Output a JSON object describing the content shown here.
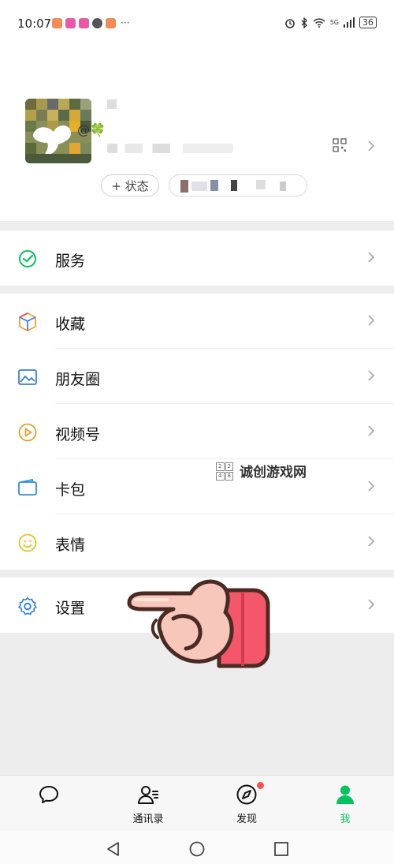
{
  "status_bar": {
    "time": "10:07",
    "more": "···",
    "network": "5G",
    "battery": "36"
  },
  "profile": {
    "nickname_fragment": "@🍀",
    "status_button": "+ 状态"
  },
  "menu": {
    "services": {
      "label": "服务"
    },
    "items": [
      {
        "label": "收藏"
      },
      {
        "label": "朋友圈"
      },
      {
        "label": "视频号"
      },
      {
        "label": "卡包"
      },
      {
        "label": "表情"
      }
    ],
    "settings": {
      "label": "设置"
    }
  },
  "watermark": {
    "text": "诚创游戏网",
    "grid": [
      "2",
      "2",
      "4",
      "8"
    ]
  },
  "tabbar": {
    "tabs": [
      {
        "label": ""
      },
      {
        "label": "通讯录"
      },
      {
        "label": "发现"
      },
      {
        "label": "我"
      }
    ]
  },
  "colors": {
    "accent": "#07c160",
    "badge": "#fa5151",
    "background": "#ededed"
  }
}
